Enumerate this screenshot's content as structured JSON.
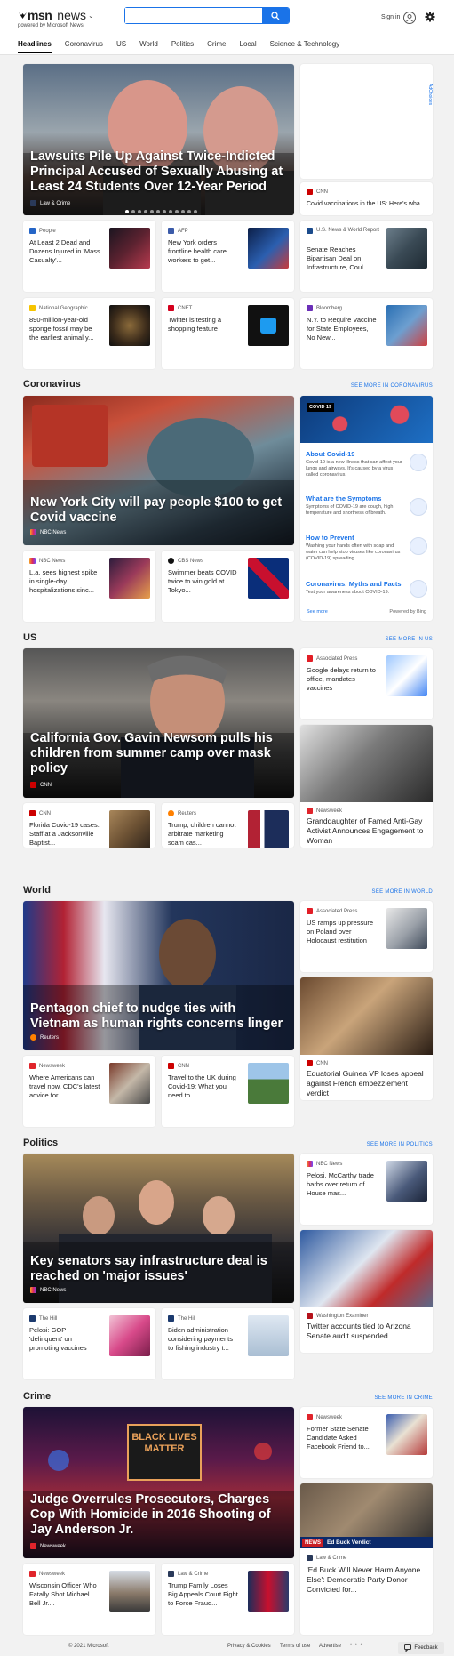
{
  "header": {
    "logo_msn": "msn",
    "logo_news": "news",
    "chevron": "⌄",
    "powered": "powered by Microsoft News",
    "search_placeholder": "",
    "signin": "Sign in"
  },
  "nav": [
    "Headlines",
    "Coronavirus",
    "US",
    "World",
    "Politics",
    "Crime",
    "Local",
    "Science & Technology"
  ],
  "ad_label": "AdChoices",
  "top": {
    "hero": {
      "title": "Lawsuits Pile Up Against Twice-Indicted Principal Accused of Sexually Abusing at Least 24 Students Over 12-Year Period",
      "source": "Law & Crime"
    },
    "right_card": {
      "source": "CNN",
      "title": "Covid vaccinations in the US: Here's wha..."
    },
    "row1": [
      {
        "source": "People",
        "title": "At Least 2 Dead and Dozens Injured in 'Mass Casualty'..."
      },
      {
        "source": "AFP",
        "title": "New York orders frontline health care workers to get..."
      },
      {
        "source": "U.S. News & World Report",
        "title": "Senate Reaches Bipartisan Deal on Infrastructure, Coul..."
      }
    ],
    "row2": [
      {
        "source": "National Geographic",
        "title": "890-million-year-old sponge fossil may be the earliest animal y..."
      },
      {
        "source": "CNET",
        "title": "Twitter is testing a shopping feature"
      },
      {
        "source": "Bloomberg",
        "title": "N.Y. to Require Vaccine for State Employees, No New..."
      }
    ]
  },
  "coronavirus": {
    "section": "Coronavirus",
    "see_more": "SEE MORE IN CORONAVIRUS",
    "hero": {
      "title": "New York City will pay people $100 to get Covid vaccine",
      "source": "NBC News"
    },
    "covid": {
      "badge": "COVID 19",
      "items": [
        {
          "heading": "About Covid-19",
          "desc": "Covid-19 is a new illness that can affect your lungs and airways. It's caused by a virus called coronavirus."
        },
        {
          "heading": "What are the Symptoms",
          "desc": "Symptoms of COVID-19 are cough, high temperature and shortness of breath."
        },
        {
          "heading": "How to Prevent",
          "desc": "Washing your hands often with soap and water can help stop viruses like coronavirus (COVID-19) spreading."
        },
        {
          "heading": "Coronavirus: Myths and Facts",
          "desc": "Test your awareness about COVID-19."
        }
      ],
      "see_more": "See more",
      "powered": "Powered by Bing"
    },
    "row": [
      {
        "source": "NBC News",
        "title": "L.a. sees highest spike in single-day hospitalizations sinc..."
      },
      {
        "source": "CBS News",
        "title": "Swimmer beats COVID twice to win gold at Tokyo..."
      }
    ]
  },
  "us": {
    "section": "US",
    "see_more": "SEE MORE IN US",
    "hero": {
      "title": "California Gov. Gavin Newsom pulls his children from summer camp over mask policy",
      "source": "CNN"
    },
    "right_top": {
      "source": "Associated Press",
      "title": "Google delays return to office, mandates vaccines"
    },
    "right_big": {
      "source": "Newsweek",
      "title": "Granddaughter of Famed Anti-Gay Activist Announces Engagement to Woman"
    },
    "row": [
      {
        "source": "CNN",
        "title": "Florida Covid-19 cases: Staff at a Jacksonville Baptist..."
      },
      {
        "source": "Reuters",
        "title": "Trump, children cannot arbitrate marketing scam cas..."
      }
    ]
  },
  "world": {
    "section": "World",
    "see_more": "SEE MORE IN WORLD",
    "hero": {
      "title": "Pentagon chief to nudge ties with Vietnam as human rights concerns linger",
      "source": "Reuters"
    },
    "right_top": {
      "source": "Associated Press",
      "title": "US ramps up pressure on Poland over Holocaust restitution"
    },
    "right_big": {
      "source": "CNN",
      "title": "Equatorial Guinea VP loses appeal against French embezzlement verdict"
    },
    "row": [
      {
        "source": "Newsweek",
        "title": "Where Americans can travel now, CDC's latest advice for..."
      },
      {
        "source": "CNN",
        "title": "Travel to the UK during Covid-19: What you need to..."
      }
    ]
  },
  "politics": {
    "section": "Politics",
    "see_more": "SEE MORE IN POLITICS",
    "hero": {
      "title": "Key senators say infrastructure deal is reached on 'major issues'",
      "source": "NBC News"
    },
    "right_top": {
      "source": "NBC News",
      "title": "Pelosi, McCarthy trade barbs over return of House mas..."
    },
    "right_big": {
      "source": "Washington Examiner",
      "title": "Twitter accounts tied to Arizona Senate audit suspended"
    },
    "row": [
      {
        "source": "The Hill",
        "title": "Pelosi: GOP 'delinquent' on promoting vaccines"
      },
      {
        "source": "The Hill",
        "title": "Biden administration considering payments to fishing industry t..."
      }
    ]
  },
  "crime": {
    "section": "Crime",
    "see_more": "SEE MORE IN CRIME",
    "hero": {
      "title": "Judge Overrules Prosecutors, Charges Cop With Homicide in 2016 Shooting of Jay Anderson Jr.",
      "source": "Newsweek",
      "sign": "BLACK LIVES MATTER"
    },
    "right_top": {
      "source": "Newsweek",
      "title": "Former State Senate Candidate Asked Facebook Friend to..."
    },
    "right_big": {
      "source": "Law & Crime",
      "title": "'Ed Buck Will Never Harm Anyone Else': Democratic Party Donor Convicted for...",
      "banner": "NEWS",
      "banner_text": "Ed Buck Verdict"
    },
    "row": [
      {
        "source": "Newsweek",
        "title": "Wisconsin Officer Who Fatally Shot Michael Bell Jr...."
      },
      {
        "source": "Law & Crime",
        "title": "Trump Family Loses Big Appeals Court Fight to Force Fraud..."
      }
    ]
  },
  "footer": {
    "copyright": "© 2021 Microsoft",
    "links": [
      "Privacy & Cookies",
      "Terms of use",
      "Advertise"
    ],
    "more": "• • •",
    "feedback": "Feedback"
  }
}
